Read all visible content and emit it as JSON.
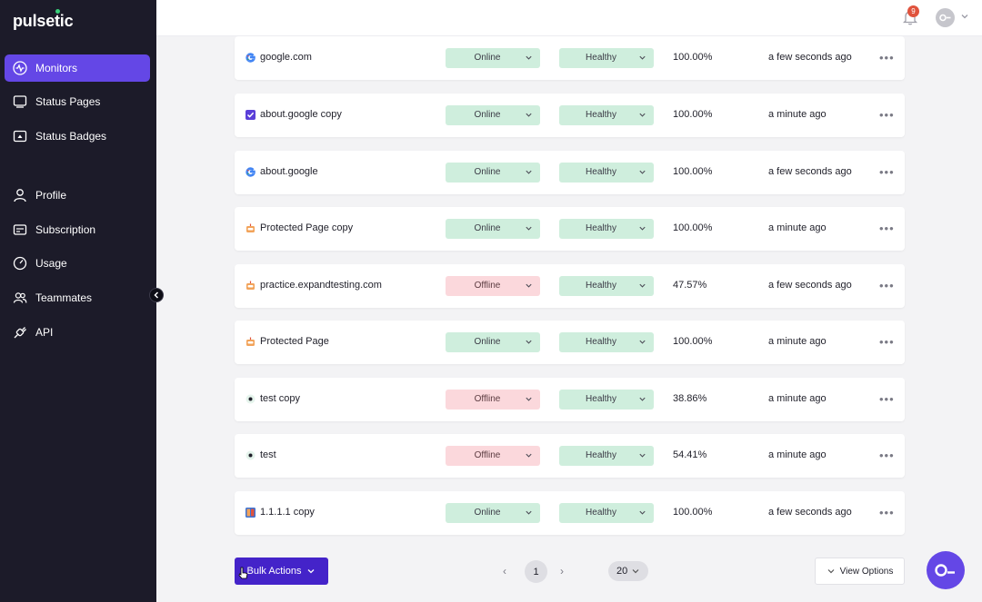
{
  "app": {
    "logo": "pulsetic"
  },
  "sidebar": {
    "items": [
      {
        "label": "Monitors",
        "icon": "monitor-pulse-icon",
        "active": true
      },
      {
        "label": "Status Pages",
        "icon": "screen-icon"
      },
      {
        "label": "Status Badges",
        "icon": "badge-icon"
      },
      {
        "label": "Profile",
        "icon": "user-icon"
      },
      {
        "label": "Subscription",
        "icon": "card-icon"
      },
      {
        "label": "Usage",
        "icon": "gauge-icon"
      },
      {
        "label": "Teammates",
        "icon": "users-icon"
      },
      {
        "label": "API",
        "icon": "plug-icon"
      }
    ]
  },
  "header": {
    "notification_count": "9"
  },
  "monitors": [
    {
      "name": "google.com",
      "icon": "google-icon",
      "status": "Online",
      "health": "Healthy",
      "uptime": "100.00%",
      "last_check": "a few seconds ago"
    },
    {
      "name": "about.google copy",
      "icon": "checkbox-icon",
      "status": "Online",
      "health": "Healthy",
      "uptime": "100.00%",
      "last_check": "a minute ago"
    },
    {
      "name": "about.google",
      "icon": "google-icon",
      "status": "Online",
      "health": "Healthy",
      "uptime": "100.00%",
      "last_check": "a few seconds ago"
    },
    {
      "name": "Protected Page copy",
      "icon": "robot-icon",
      "status": "Online",
      "health": "Healthy",
      "uptime": "100.00%",
      "last_check": "a minute ago"
    },
    {
      "name": "practice.expandtesting.com",
      "icon": "robot-icon",
      "status": "Offline",
      "health": "Healthy",
      "uptime": "47.57%",
      "last_check": "a few seconds ago"
    },
    {
      "name": "Protected Page",
      "icon": "robot-icon",
      "status": "Online",
      "health": "Healthy",
      "uptime": "100.00%",
      "last_check": "a minute ago"
    },
    {
      "name": "test copy",
      "icon": "dot-icon",
      "status": "Offline",
      "health": "Healthy",
      "uptime": "38.86%",
      "last_check": "a minute ago"
    },
    {
      "name": "test",
      "icon": "dot-icon",
      "status": "Offline",
      "health": "Healthy",
      "uptime": "54.41%",
      "last_check": "a minute ago"
    },
    {
      "name": "1.1.1.1 copy",
      "icon": "cloudflare-icon",
      "status": "Online",
      "health": "Healthy",
      "uptime": "100.00%",
      "last_check": "a few seconds ago"
    }
  ],
  "footer": {
    "bulk_actions": "Bulk Actions",
    "page": "1",
    "per_page": "20",
    "view_options": "View Options"
  },
  "colors": {
    "accent": "#6447e6",
    "sidebar": "#1c1b29",
    "online": "#cfeedd",
    "offline": "#fbd8dc",
    "bulk": "#4423c9"
  }
}
